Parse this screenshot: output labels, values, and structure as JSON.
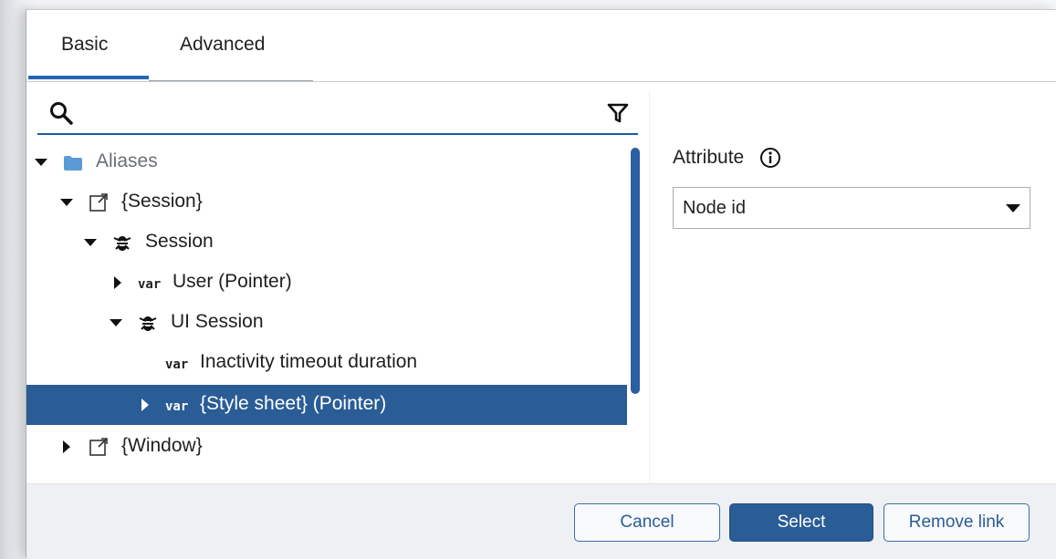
{
  "tabs": [
    {
      "label": "Basic",
      "active": true
    },
    {
      "label": "Advanced",
      "active": false
    }
  ],
  "search": {
    "value": "",
    "placeholder": ""
  },
  "tree": {
    "rows": [
      {
        "label": "Aliases",
        "icon": "folder-icon",
        "expanded": true
      },
      {
        "label": "{Session}",
        "icon": "link-icon",
        "expanded": true
      },
      {
        "label": "Session",
        "icon": "bee-icon",
        "expanded": true
      },
      {
        "prefix": "var",
        "label": "User (Pointer)",
        "expanded": false
      },
      {
        "label": "UI Session",
        "icon": "bee-icon",
        "expanded": true
      },
      {
        "prefix": "var",
        "label": "Inactivity timeout duration"
      },
      {
        "prefix": "var",
        "label": "{Style sheet} (Pointer)",
        "expanded": false,
        "selected": true
      },
      {
        "label": "{Window}",
        "icon": "link-icon",
        "expanded": false
      }
    ]
  },
  "attribute": {
    "label": "Attribute",
    "value": "Node id"
  },
  "buttons": {
    "cancel": "Cancel",
    "select": "Select",
    "remove": "Remove link"
  },
  "colors": {
    "accent": "#2a5c96",
    "folder": "#5b9bd5"
  }
}
